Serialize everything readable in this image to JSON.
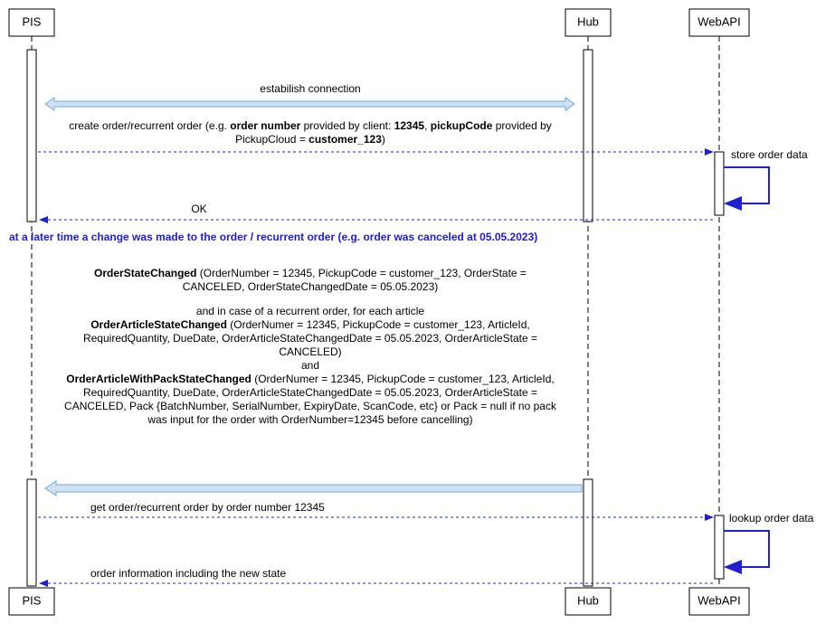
{
  "participants": {
    "pis": "PIS",
    "hub": "Hub",
    "webapi": "WebAPI"
  },
  "messages": {
    "establish": "estabilish connection",
    "create_order_pre": "create order/recurrent order (e.g. ",
    "create_order_bold1": "order number",
    "create_order_mid1": " provided by client: ",
    "create_order_bold2": "12345",
    "create_order_mid2": ", ",
    "create_order_bold3": "pickupCode",
    "create_order_mid3": " provided by",
    "create_order_line2_pre": "PickupCloud = ",
    "create_order_line2_bold": "customer_123",
    "create_order_line2_post": ")",
    "store_order": "store order data",
    "ok": "OK",
    "change_note": "at a later time a change was made to the order / recurrent order (e.g. order was canceled at 05.05.2023)",
    "osc_bold": "OrderStateChanged",
    "osc_rest": " (OrderNumber = 12345, PickupCode = customer_123, OrderState =",
    "osc_line2": "CANCELED, OrderStateChangedDate = 05.05.2023)",
    "and_recurrent": "and in case of a recurrent order, for each article",
    "oasc_bold": "OrderArticleStateChanged",
    "oasc_rest": " (OrderNumer = 12345, PickupCode = customer_123, ArticleId,",
    "oasc_line2": "RequiredQuantity, DueDate, OrderArticleStateChangedDate = 05.05.2023, OrderArticleState =",
    "oasc_line3": "CANCELED)",
    "and": "and",
    "oawpsc_bold": "OrderArticleWithPackStateChanged",
    "oawpsc_rest": " (OrderNumer = 12345, PickupCode = customer_123, ArticleId,",
    "oawpsc_line2": "RequiredQuantity, DueDate, OrderArticleStateChangedDate = 05.05.2023, OrderArticleState =",
    "oawpsc_line3": "CANCELED, Pack {BatchNumber, SerialNumber, ExpiryDate, ScanCode, etc} or Pack = null if no pack",
    "oawpsc_line4": "was input for the order with OrderNumber=12345 before cancelling)",
    "get_order": "get order/recurrent order by order number 12345",
    "lookup": "lookup order data",
    "order_info": "order information including the new state"
  }
}
